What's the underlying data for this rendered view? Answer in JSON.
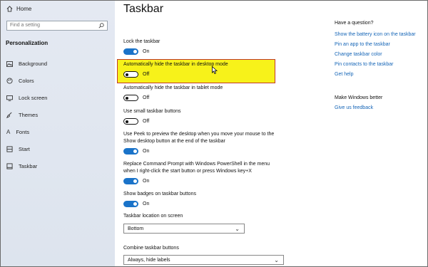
{
  "sidebar": {
    "home_label": "Home",
    "search_placeholder": "Find a setting",
    "section_title": "Personalization",
    "items": [
      {
        "label": "Background",
        "icon": "picture-icon"
      },
      {
        "label": "Colors",
        "icon": "palette-icon"
      },
      {
        "label": "Lock screen",
        "icon": "lock-screen-icon"
      },
      {
        "label": "Themes",
        "icon": "brush-icon"
      },
      {
        "label": "Fonts",
        "icon": "font-icon"
      },
      {
        "label": "Start",
        "icon": "start-icon"
      },
      {
        "label": "Taskbar",
        "icon": "taskbar-icon"
      }
    ]
  },
  "main": {
    "title": "Taskbar",
    "settings": [
      {
        "label": "Lock the taskbar",
        "state": "On"
      },
      {
        "label": "Automatically hide the taskbar in desktop mode",
        "state": "Off"
      },
      {
        "label": "Automatically hide the taskbar in tablet mode",
        "state": "Off"
      },
      {
        "label": "Use small taskbar buttons",
        "state": "Off"
      },
      {
        "label_line1": "Use Peek to preview the desktop when you move your mouse to the",
        "label_line2": "Show desktop button at the end of the taskbar",
        "state": "On"
      },
      {
        "label_line1": "Replace Command Prompt with Windows PowerShell in the menu",
        "label_line2": "when I right-click the start button or press Windows key+X",
        "state": "On"
      },
      {
        "label": "Show badges on taskbar buttons",
        "state": "On"
      }
    ],
    "location": {
      "label": "Taskbar location on screen",
      "value": "Bottom"
    },
    "combine": {
      "label": "Combine taskbar buttons",
      "value": "Always, hide labels"
    }
  },
  "help": {
    "heading": "Have a question?",
    "links": [
      "Show the battery icon on the taskbar",
      "Pin an app to the taskbar",
      "Change taskbar color",
      "Pin contacts to the taskbar",
      "Get help"
    ],
    "better_heading": "Make Windows better",
    "feedback_link": "Give us feedback"
  },
  "colors": {
    "accent": "#1a73c9",
    "highlight": "#f7f21a",
    "link": "#1565b7"
  }
}
